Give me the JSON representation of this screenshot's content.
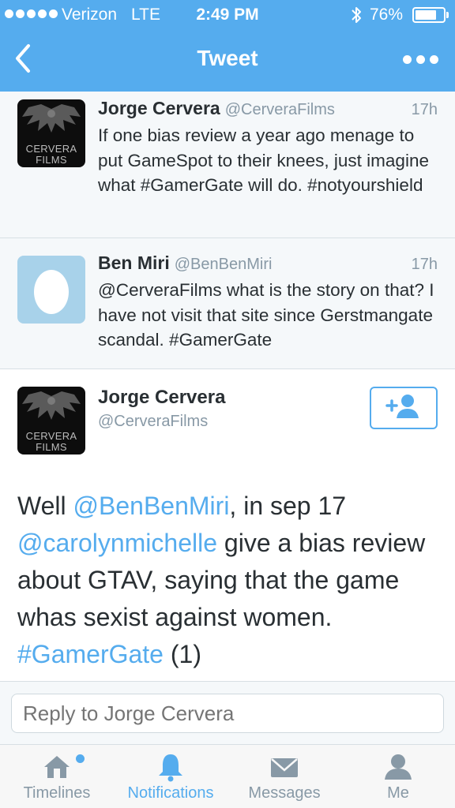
{
  "status_bar": {
    "carrier": "Verizon",
    "network": "LTE",
    "time": "2:49 PM",
    "battery": "76%",
    "battery_level": 0.76
  },
  "nav": {
    "title": "Tweet",
    "back_icon": "chevron-left-icon",
    "more_icon": "more-dots-icon"
  },
  "thread": [
    {
      "name": "Jorge Cervera",
      "handle": "@CerveraFilms",
      "time": "17h",
      "text": "If one bias review a year ago menage to put GameSpot to their knees, just imagine what #GamerGate will do. #notyourshield",
      "avatar_text": [
        "CERVERA",
        "FILMS"
      ]
    },
    {
      "name": "Ben Miri",
      "handle": "@BenBenMiri",
      "time": "17h",
      "text": "@CerveraFilms what is the story on that? I have not visit that site since Gerstmangate scandal. #GamerGate",
      "avatar_icon": "egg-icon"
    }
  ],
  "main_tweet": {
    "name": "Jorge Cervera",
    "handle": "@CerveraFilms",
    "avatar_text": [
      "CERVERA",
      "FILMS"
    ],
    "follow_icon": "follow-user-icon",
    "text_parts": {
      "p1": "Well ",
      "p2": "@BenBenMiri",
      "p3": ", in sep 17 ",
      "p4": "@carolynmichelle",
      "p5": " give a bias review about GTAV, saying that the game whas sexist against women. ",
      "p6": "#GamerGate",
      "p7": " (1)"
    }
  },
  "reply": {
    "placeholder": "Reply to Jorge Cervera"
  },
  "tabs": [
    {
      "label": "Timelines",
      "icon": "home-icon"
    },
    {
      "label": "Notifications",
      "icon": "bell-icon"
    },
    {
      "label": "Messages",
      "icon": "envelope-icon"
    },
    {
      "label": "Me",
      "icon": "person-icon"
    }
  ],
  "colors": {
    "brand": "#55acee",
    "muted": "#8899a6",
    "text": "#292f33"
  }
}
